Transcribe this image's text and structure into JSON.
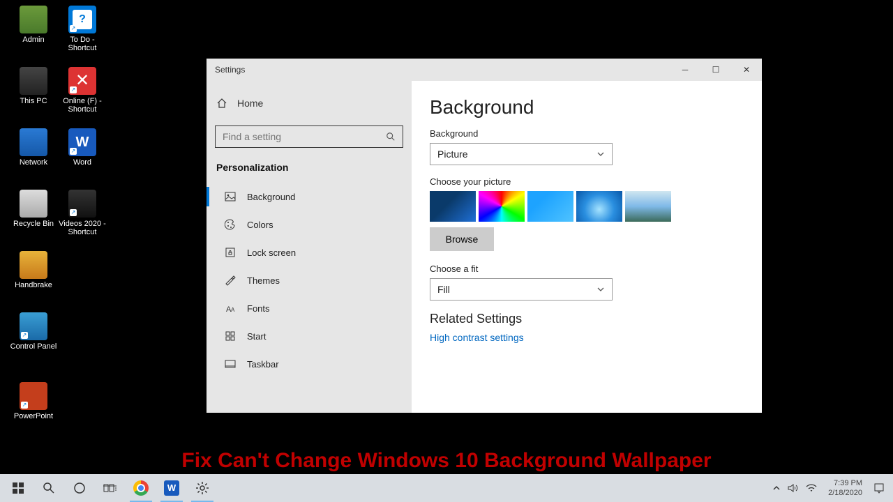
{
  "desktop": {
    "icons": [
      {
        "label": "Admin"
      },
      {
        "label": "To Do - Shortcut"
      },
      {
        "label": "This PC"
      },
      {
        "label": "Online (F) - Shortcut"
      },
      {
        "label": "Network"
      },
      {
        "label": "Word"
      },
      {
        "label": "Recycle Bin"
      },
      {
        "label": "Videos 2020 - Shortcut"
      },
      {
        "label": "Handbrake"
      },
      {
        "label": "Control Panel"
      },
      {
        "label": "PowerPoint"
      }
    ]
  },
  "settings": {
    "title": "Settings",
    "home": "Home",
    "search_placeholder": "Find a setting",
    "category": "Personalization",
    "items": [
      {
        "label": "Background",
        "active": true
      },
      {
        "label": "Colors"
      },
      {
        "label": "Lock screen"
      },
      {
        "label": "Themes"
      },
      {
        "label": "Fonts"
      },
      {
        "label": "Start"
      },
      {
        "label": "Taskbar"
      }
    ],
    "content": {
      "heading": "Background",
      "bg_label": "Background",
      "bg_value": "Picture",
      "choose_pic": "Choose your picture",
      "browse": "Browse",
      "fit_label": "Choose a fit",
      "fit_value": "Fill",
      "related": "Related Settings",
      "link": "High contrast settings"
    }
  },
  "caption": "Fix Can't Change Windows 10 Background Wallpaper",
  "taskbar": {
    "time": "7:39 PM",
    "date": "2/18/2020"
  }
}
